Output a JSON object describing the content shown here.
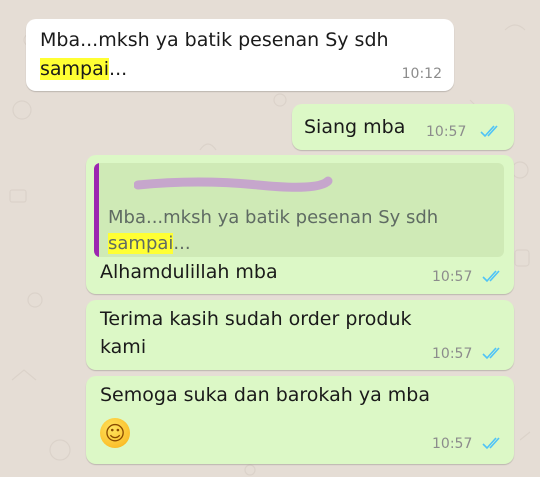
{
  "messages": [
    {
      "direction": "incoming",
      "lines": [
        "Mba...mksh ya batik pesenan Sy sdh"
      ],
      "highlight": "sampai",
      "highlight_suffix": "...",
      "time": "10:12"
    },
    {
      "direction": "outgoing",
      "text": "Siang mba",
      "time": "10:57",
      "status": "read"
    },
    {
      "direction": "outgoing",
      "quoted": {
        "line": "Mba...mksh ya batik pesenan Sy sdh",
        "highlight": "sampai",
        "highlight_suffix": "..."
      },
      "text": "Alhamdulillah mba",
      "time": "10:57",
      "status": "read"
    },
    {
      "direction": "outgoing",
      "lines": [
        "Terima kasih sudah order produk",
        "kami"
      ],
      "time": "10:57",
      "status": "read"
    },
    {
      "direction": "outgoing",
      "text": "Semoga suka dan barokah ya mba",
      "emoji": "smiling-face-emoji",
      "time": "10:57",
      "status": "read"
    }
  ],
  "colors": {
    "background": "#e5ddd5",
    "incoming_bubble": "#ffffff",
    "outgoing_bubble": "#dcf8c6",
    "highlight": "#ffff33",
    "read_ticks": "#4fc3f7",
    "quote_bar": "#9c27b0"
  }
}
